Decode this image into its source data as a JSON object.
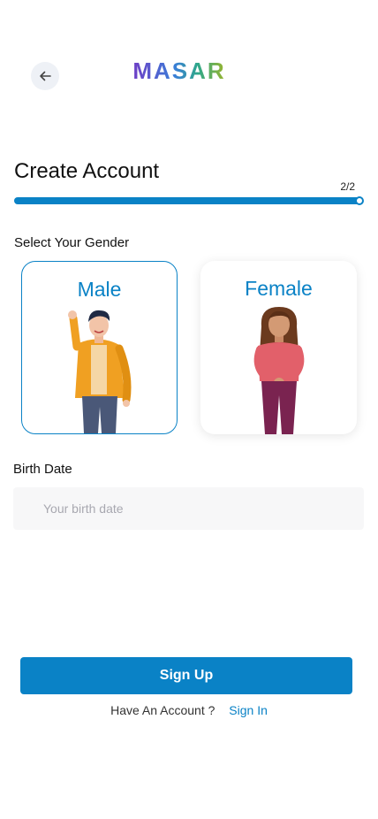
{
  "header": {
    "back_icon": "arrow-left-icon",
    "logo_text": "MASAR",
    "logo_gradient": [
      "#6f3fc6",
      "#3a7ed8",
      "#2fa88a",
      "#9cb52a"
    ]
  },
  "page": {
    "title": "Create Account",
    "step_label": "2/2",
    "progress": 1.0
  },
  "gender": {
    "label": "Select Your Gender",
    "options": [
      {
        "label": "Male",
        "selected": true
      },
      {
        "label": "Female",
        "selected": false
      }
    ]
  },
  "birth": {
    "label": "Birth Date",
    "placeholder": "Your birth date",
    "value": ""
  },
  "actions": {
    "signup_label": "Sign Up",
    "have_account": "Have An Account ?",
    "signin_label": "Sign In"
  },
  "colors": {
    "accent": "#0a82c6",
    "input_bg": "#f7f7f8"
  }
}
